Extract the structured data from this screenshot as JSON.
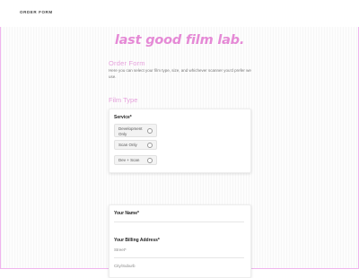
{
  "header": {
    "nav_label": "ORDER FORM"
  },
  "hero": {
    "title": "last good film lab."
  },
  "intro": {
    "title": "Order Form",
    "description": "Here you can select your film type, size, and whichever scanner you'd prefer we use."
  },
  "film_type_section": {
    "title": "Film Type",
    "service": {
      "label": "Service*",
      "options": [
        {
          "label": "Development Only"
        },
        {
          "label": "Scan Only"
        },
        {
          "label": "Dev + Scan"
        }
      ]
    }
  },
  "details": {
    "name_label": "Your Name*",
    "billing_label": "Your Billing Address*",
    "street_label": "Street*",
    "city_label": "City/Suburb"
  },
  "colors": {
    "accent": "#e58ad6",
    "accent_light": "#e6a2dc",
    "border": "#f0b4ee"
  }
}
